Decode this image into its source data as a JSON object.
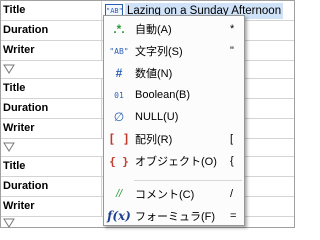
{
  "grid": {
    "rows": [
      {
        "type": "key",
        "key": "Title"
      },
      {
        "type": "key",
        "key": "Duration"
      },
      {
        "type": "key",
        "key": "Writer"
      },
      {
        "type": "sep"
      },
      {
        "type": "key",
        "key": "Title"
      },
      {
        "type": "key",
        "key": "Duration"
      },
      {
        "type": "key",
        "key": "Writer"
      },
      {
        "type": "sep"
      },
      {
        "type": "key",
        "key": "Title"
      },
      {
        "type": "key",
        "key": "Duration"
      },
      {
        "type": "key",
        "key": "Writer"
      },
      {
        "type": "sep"
      }
    ],
    "active_cell": {
      "type_badge": "\"AB\"",
      "value": "Lazing on a Sunday Afternoon"
    }
  },
  "context_menu": {
    "items": [
      {
        "id": "auto",
        "icon": "auto-type-icon",
        "icon_glyph": ".*.",
        "label": "自動(A)",
        "shortcut": "*"
      },
      {
        "id": "string",
        "icon": "string-type-icon",
        "icon_glyph": "\"AB\"",
        "label": "文字列(S)",
        "shortcut": "\""
      },
      {
        "id": "number",
        "icon": "number-type-icon",
        "icon_glyph": "#",
        "label": "数値(N)",
        "shortcut": ""
      },
      {
        "id": "boolean",
        "icon": "boolean-type-icon",
        "icon_glyph": "01",
        "label": "Boolean(B)",
        "shortcut": ""
      },
      {
        "id": "null",
        "icon": "null-type-icon",
        "icon_glyph": "∅",
        "label": "NULL(U)",
        "shortcut": ""
      },
      {
        "id": "array",
        "icon": "array-type-icon",
        "icon_glyph": "[ ]",
        "label": "配列(R)",
        "shortcut": "["
      },
      {
        "id": "object",
        "icon": "object-type-icon",
        "icon_glyph": "{ }",
        "label": "オブジェクト(O)",
        "shortcut": "{"
      },
      {
        "id": "comment",
        "icon": "comment-icon",
        "icon_glyph": "//",
        "label": "コメント(C)",
        "shortcut": "/"
      },
      {
        "id": "formula",
        "icon": "formula-icon",
        "icon_glyph": "f(x)",
        "label": "フォーミュラ(F)",
        "shortcut": "="
      }
    ]
  },
  "colors": {
    "grid_line": "#d4d4d4",
    "selection": "#cfe2f8",
    "type_blue": "#2b5fb4",
    "type_green": "#2a9a3a",
    "type_red": "#c0392b"
  }
}
